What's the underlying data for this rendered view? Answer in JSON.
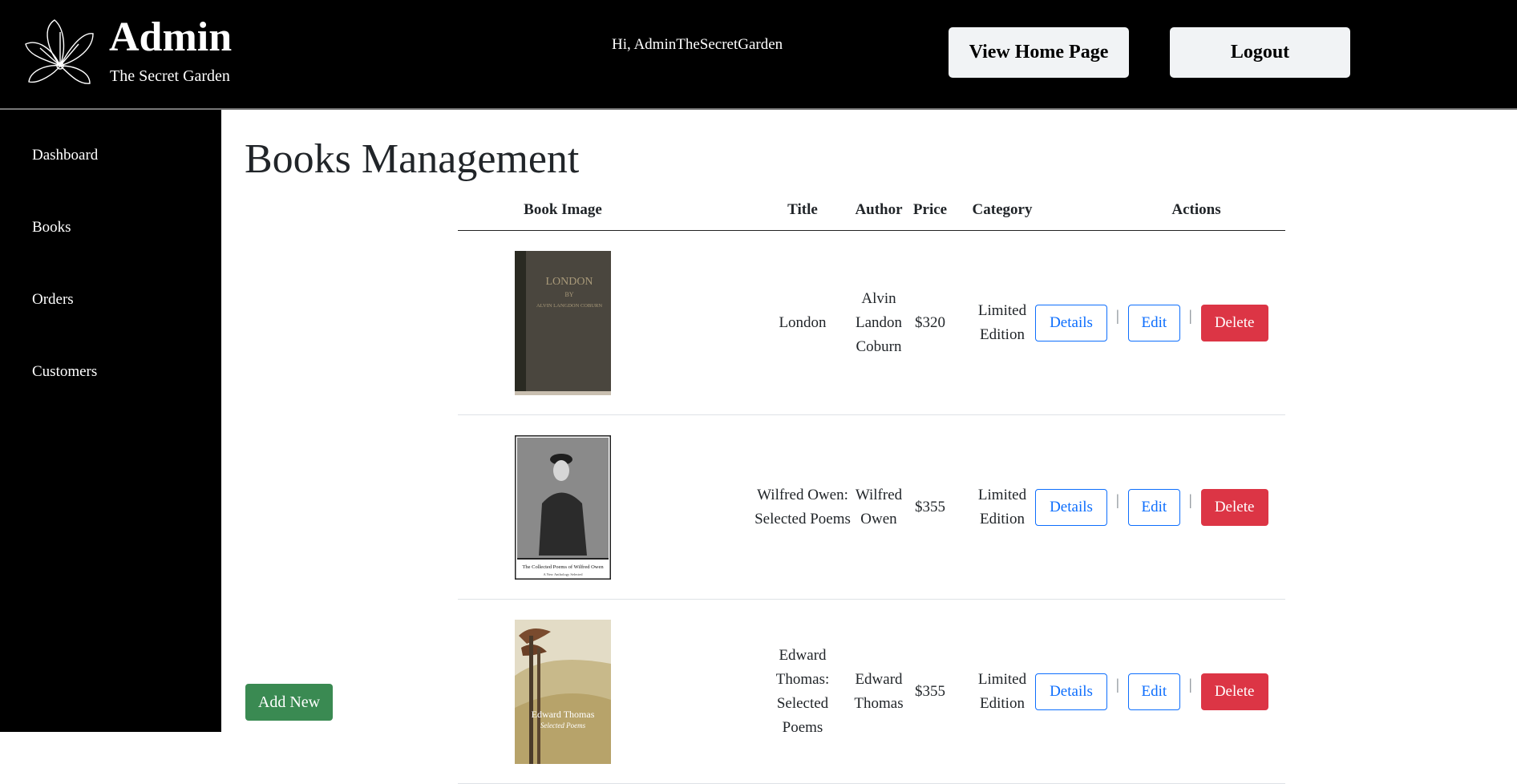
{
  "header": {
    "title": "Admin",
    "subtitle": "The Secret Garden",
    "greeting": "Hi, AdminTheSecretGarden",
    "view_home_label": "View Home Page",
    "logout_label": "Logout",
    "logo_icon": "flower-logo-icon"
  },
  "sidebar": {
    "items": [
      {
        "label": "Dashboard"
      },
      {
        "label": "Books"
      },
      {
        "label": "Orders"
      },
      {
        "label": "Customers"
      }
    ]
  },
  "main": {
    "title": "Books Management",
    "add_new_label": "Add New",
    "columns": [
      "Book Image",
      "Title",
      "Author",
      "Price",
      "Category",
      "Actions"
    ],
    "actions": {
      "details": "Details",
      "edit": "Edit",
      "delete": "Delete",
      "separator": "|"
    },
    "rows": [
      {
        "title": "London",
        "author": "Alvin Landon Coburn",
        "price": "$320",
        "category": "Limited Edition",
        "cover_title": "LONDON",
        "cover_by": "BY",
        "cover_author": "ALVIN LANGDON COBURN"
      },
      {
        "title": "Wilfred Owen: Selected Poems",
        "author": "Wilfred Owen",
        "price": "$355",
        "category": "Limited Edition",
        "cover_caption": "The Collected Poems of Wilfred Owen",
        "cover_sub": "A New Anthology Selected"
      },
      {
        "title": "Edward Thomas: Selected Poems",
        "author": "Edward Thomas",
        "price": "$355",
        "category": "Limited Edition",
        "cover_title": "Edward Thomas",
        "cover_sub": "Selected Poems"
      }
    ]
  },
  "colors": {
    "primary": "#0d6efd",
    "danger": "#dc3545",
    "success": "#3a8a52",
    "header_bg": "#000000"
  }
}
